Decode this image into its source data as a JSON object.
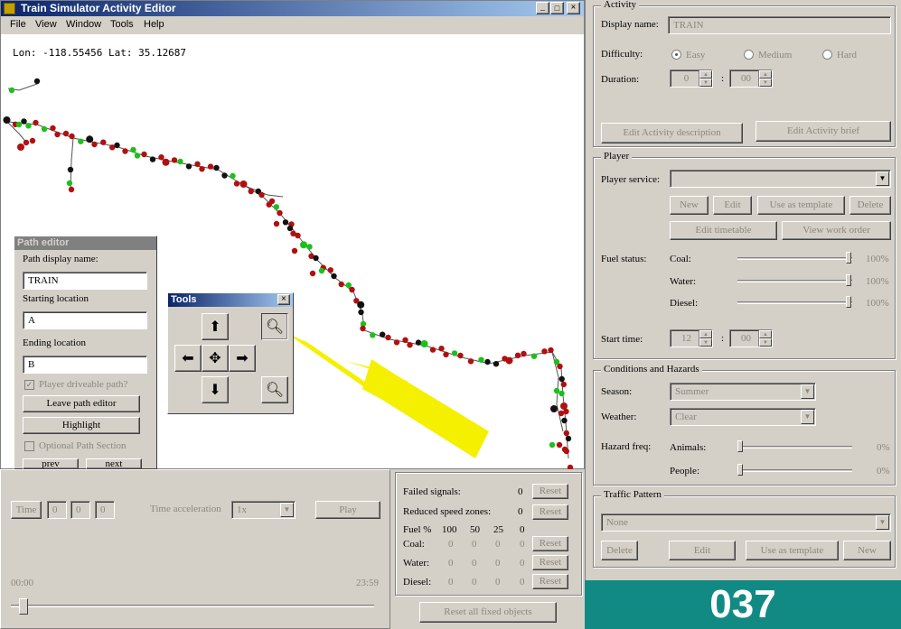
{
  "window": {
    "title": "Train Simulator Activity Editor"
  },
  "menu": [
    "File",
    "View",
    "Window",
    "Tools",
    "Help"
  ],
  "map": {
    "coords": "Lon: -118.55456 Lat: 35.12687"
  },
  "path_editor": {
    "title": "Path editor",
    "name_label": "Path display name:",
    "name_value": "TRAIN",
    "start_label": "Starting location",
    "start_value": "A",
    "end_label": "Ending location",
    "end_value": "B",
    "driveable_label": "Player driveable path?",
    "leave_label": "Leave path editor",
    "highlight_label": "Highlight",
    "optional_label": "Optional Path Section",
    "prev_label": "prev",
    "next_label": "next"
  },
  "tools": {
    "title": "Tools",
    "close": "×"
  },
  "activity": {
    "title": "Activity",
    "display_name_label": "Display name:",
    "display_name_value": "TRAIN",
    "difficulty_label": "Difficulty:",
    "easy": "Easy",
    "medium": "Medium",
    "hard": "Hard",
    "duration_label": "Duration:",
    "duration_h": "0",
    "duration_m": "00",
    "edit_desc": "Edit Activity description",
    "edit_brief": "Edit Activity brief"
  },
  "player": {
    "title": "Player",
    "service_label": "Player service:",
    "new": "New",
    "edit": "Edit",
    "use_template": "Use as template",
    "delete": "Delete",
    "edit_timetable": "Edit timetable",
    "view_work_order": "View work order",
    "fuel_label": "Fuel status:",
    "fuel": [
      {
        "name": "Coal:",
        "value": "100%",
        "level": 1.0
      },
      {
        "name": "Water:",
        "value": "100%",
        "level": 1.0
      },
      {
        "name": "Diesel:",
        "value": "100%",
        "level": 1.0
      }
    ],
    "start_label": "Start time:",
    "start_h": "12",
    "start_m": "00"
  },
  "conditions": {
    "title": "Conditions and Hazards",
    "season_label": "Season:",
    "season_value": "Summer",
    "weather_label": "Weather:",
    "weather_value": "Clear",
    "hazard_label": "Hazard freq:",
    "hazards": [
      {
        "name": "Animals:",
        "value": "0%",
        "level": 0
      },
      {
        "name": "People:",
        "value": "0%",
        "level": 0
      }
    ]
  },
  "traffic": {
    "title": "Traffic Pattern",
    "value": "None",
    "delete": "Delete",
    "edit": "Edit",
    "use_template": "Use as template",
    "new": "New"
  },
  "timeline": {
    "time_label": "Time",
    "fields": [
      "0",
      "0",
      "0"
    ],
    "accel_label": "Time acceleration",
    "accel_value": "1x",
    "play_label": "Play",
    "start": "00:00",
    "end": "23:59",
    "position": 0.0
  },
  "failures": {
    "failed_label": "Failed signals:",
    "failed_value": "0",
    "reset": "Reset",
    "reduced_label": "Reduced speed zones:",
    "reduced_value": "0",
    "fuel_header": [
      "Fuel %",
      "100",
      "50",
      "25",
      "0"
    ],
    "rows": [
      {
        "name": "Coal:",
        "vals": [
          "0",
          "0",
          "0",
          "0"
        ]
      },
      {
        "name": "Water:",
        "vals": [
          "0",
          "0",
          "0",
          "0"
        ]
      },
      {
        "name": "Diesel:",
        "vals": [
          "0",
          "0",
          "0",
          "0"
        ]
      }
    ],
    "reset_all": "Reset all fixed objects"
  },
  "badge": {
    "text": "037",
    "color": "#128a84"
  }
}
